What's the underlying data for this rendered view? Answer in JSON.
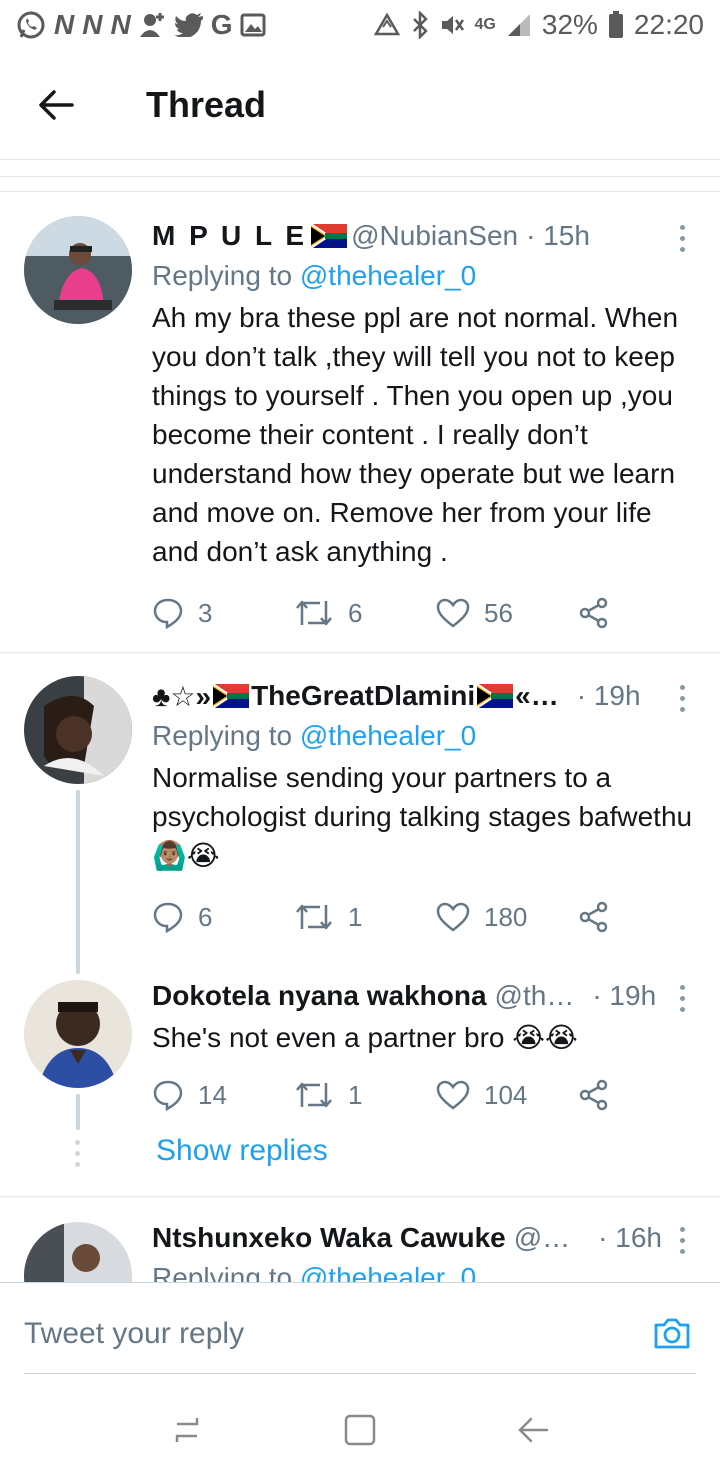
{
  "status_bar": {
    "left_icons": [
      "whatsapp-icon",
      "news-icon",
      "news-icon",
      "news-icon",
      "add-user-icon",
      "twitter-icon",
      "google-icon",
      "image-icon"
    ],
    "network": "4G",
    "battery": "32%",
    "time": "22:20"
  },
  "header": {
    "title": "Thread"
  },
  "tweets": [
    {
      "name": "M P U L E",
      "handle": "@NubianSen",
      "time": "· 15h",
      "reply_prefix": "Replying to",
      "reply_to": "@thehealer_0",
      "text": "Ah my bra these ppl are not normal. When you don’t talk ,they will tell you not to keep things to yourself . Then you open up ,you become their content . I really don’t understand how they operate but we learn and move on. Remove her from your life and don’t ask anything .",
      "replies": "3",
      "retweets": "6",
      "likes": "56"
    },
    {
      "name_prefix": "♣☆»",
      "name": "TheGreatDlamini",
      "name_suffix": "«…",
      "time": "· 19h",
      "reply_prefix": "Replying to",
      "reply_to": "@thehealer_0",
      "text": "Normalise sending your partners to a psychologist during talking stages bafwethu 🙆🏽‍♂️😭",
      "replies": "6",
      "retweets": "1",
      "likes": "180"
    },
    {
      "name": "Dokotela nyana wakhona",
      "handle": "@th…",
      "time": "· 19h",
      "text": "She's not even a partner bro 😭😭",
      "replies": "14",
      "retweets": "1",
      "likes": "104"
    },
    {
      "name": "Ntshunxeko Waka Cawuke",
      "handle": "@…",
      "time": "· 16h",
      "reply_prefix": "Replying to",
      "reply_to": "@thehealer_0"
    }
  ],
  "show_replies": "Show replies",
  "composer": {
    "placeholder": "Tweet your reply"
  },
  "colors": {
    "accent": "#1da1f2",
    "muted": "#657786",
    "border": "#e1e8ed"
  }
}
